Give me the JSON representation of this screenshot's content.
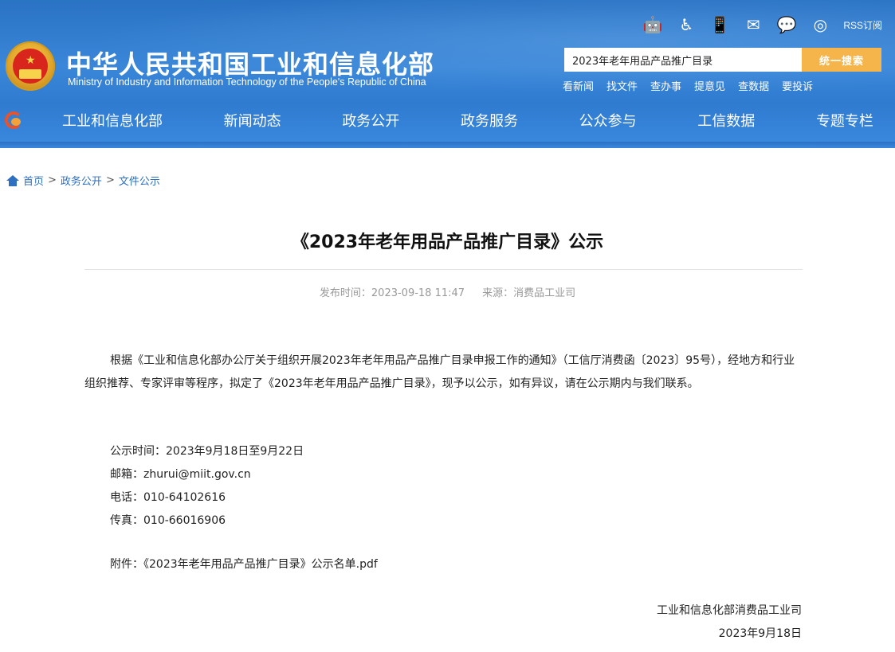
{
  "header": {
    "title_cn": "中华人民共和国工业和信息化部",
    "title_en": "Ministry of Industry and Information Technology of the People's Republic of China",
    "top_icons": [
      {
        "name": "robot-icon",
        "glyph": "🤖"
      },
      {
        "name": "accessibility-icon",
        "glyph": "♿"
      },
      {
        "name": "mobile-icon",
        "glyph": "📱"
      },
      {
        "name": "mail-icon",
        "glyph": "✉"
      },
      {
        "name": "wechat-icon",
        "glyph": "💬"
      },
      {
        "name": "weibo-icon",
        "glyph": "◎"
      }
    ],
    "rss_label": "RSS订阅",
    "search": {
      "value": "2023年老年用品产品推广目录",
      "button_label": "统一搜索"
    },
    "quick_links": [
      "看新闻",
      "找文件",
      "查办事",
      "提意见",
      "查数据",
      "要投诉"
    ],
    "nav_items": [
      "工业和信息化部",
      "新闻动态",
      "政务公开",
      "政务服务",
      "公众参与",
      "工信数据",
      "专题专栏"
    ]
  },
  "breadcrumb": {
    "items": [
      "首页",
      "政务公开",
      "文件公示"
    ],
    "separator": ">"
  },
  "article": {
    "title": "《2023年老年用品产品推广目录》公示",
    "publish_time": "发布时间：2023-09-18 11:47",
    "source": "来源：消费品工业司",
    "paragraph": "根据《工业和信息化部办公厅关于组织开展2023年老年用品产品推广目录申报工作的通知》（工信厅消费函〔2023〕95号），经地方和行业组织推荐、专家评审等程序，拟定了《2023年老年用品产品推广目录》，现予以公示，如有异议，请在公示期内与我们联系。",
    "info_lines": [
      "公示时间：2023年9月18日至9月22日",
      "邮箱：zhurui@miit.gov.cn",
      "电话：010-64102616",
      "传真：010-66016906"
    ],
    "attachment_label": "附件：",
    "attachment_name": "《2023年老年用品产品推广目录》公示名单.pdf",
    "signature_dept": "工业和信息化部消费品工业司",
    "signature_date": "2023年9月18日"
  },
  "colors": {
    "header_blue": "#2f7bd0",
    "search_button": "#f5b54a",
    "link_blue": "#2e6fc0"
  }
}
